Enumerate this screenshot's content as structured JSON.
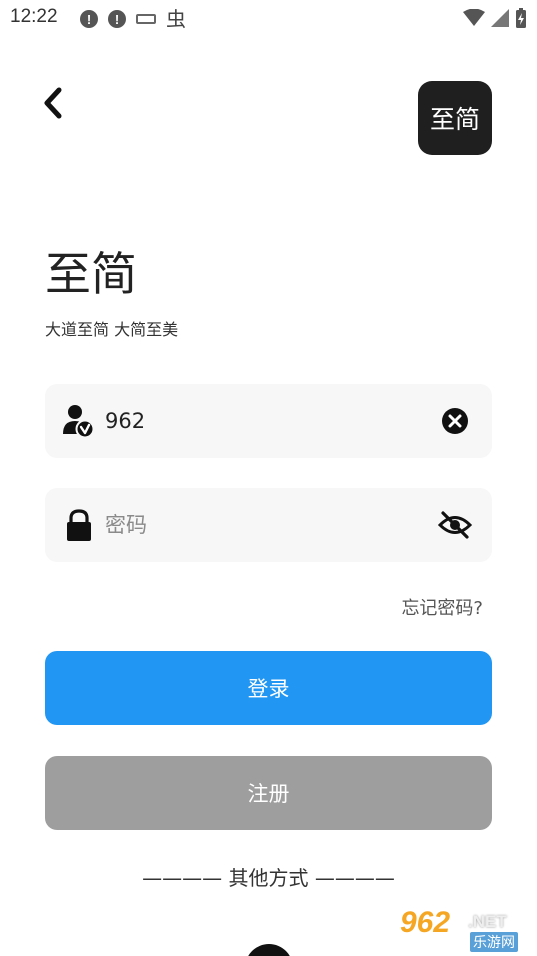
{
  "status_bar": {
    "time": "12:22",
    "alert_glyph": "!",
    "bug_glyph": "虫"
  },
  "header": {
    "logo_text": "至简"
  },
  "brand": {
    "title": "至简",
    "slogan": "大道至简 大简至美"
  },
  "login_form": {
    "username_value": "962",
    "password_placeholder": "密码",
    "forgot_label": "忘记密码?",
    "login_label": "登录",
    "register_label": "注册",
    "other_ways_label": "———— 其他方式 ————"
  },
  "watermark": {
    "number": "962",
    "suffix": ".NET",
    "site_name": "乐游网"
  },
  "colors": {
    "accent": "#2196f3",
    "register_gray": "#9e9e9e",
    "logo_bg": "#1f1f1f",
    "field_bg": "#f7f7f7"
  },
  "icons": {
    "back": "chevron-left-icon",
    "user": "user-verified-icon",
    "clear": "clear-circle-icon",
    "lock": "lock-icon",
    "visibility": "eye-off-icon",
    "wifi": "wifi-icon",
    "signal": "signal-icon",
    "battery": "battery-charging-icon"
  }
}
